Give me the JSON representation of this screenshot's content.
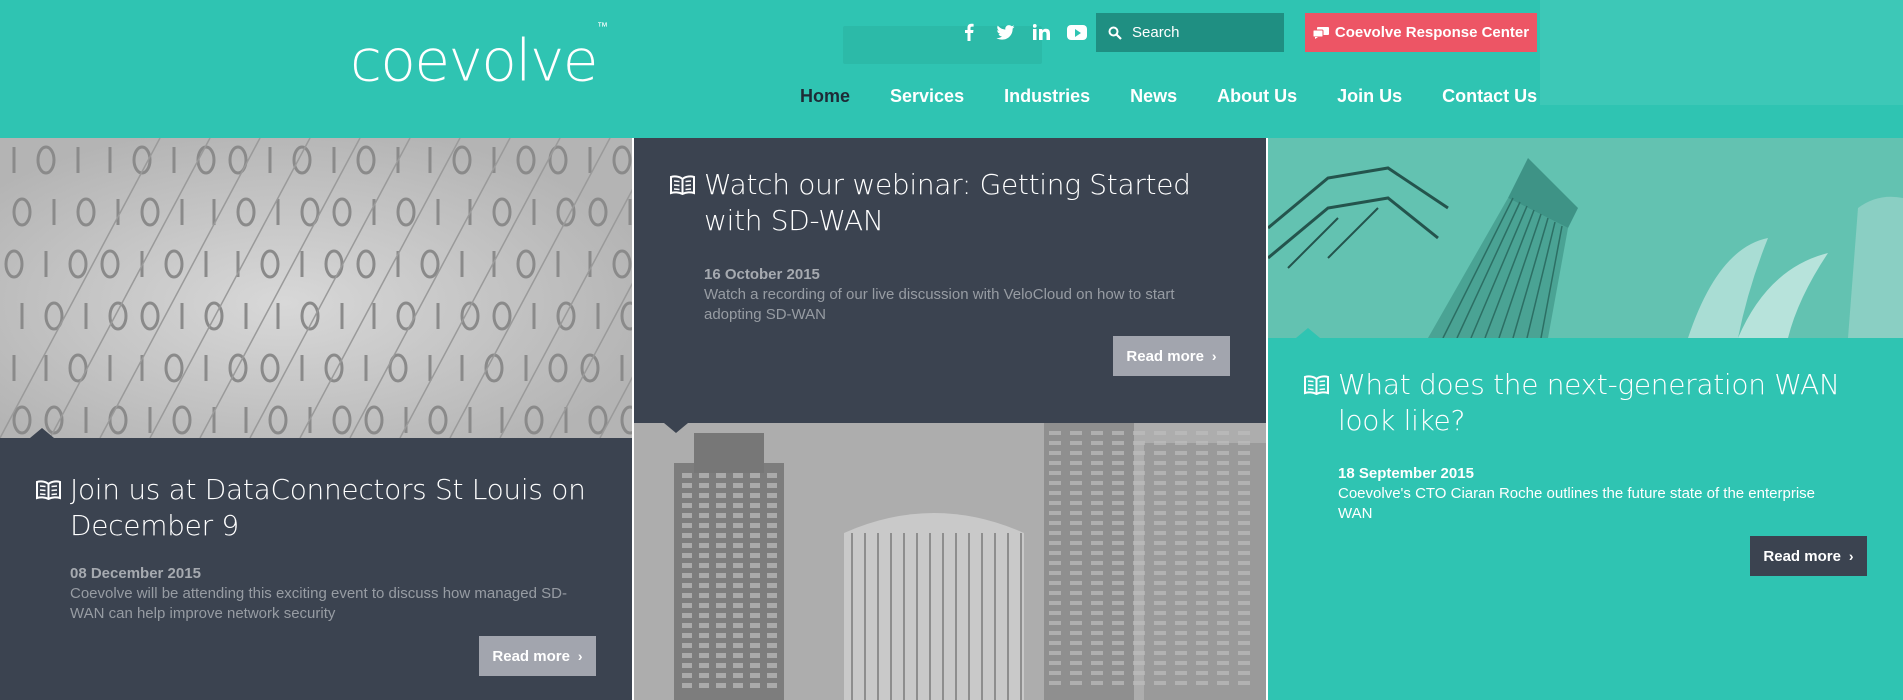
{
  "brand": {
    "logo_text": "coevolve",
    "trademark": "™"
  },
  "colors": {
    "teal": "#2fc4b2",
    "dark": "#3b4350",
    "red": "#ed5565",
    "grey_button": "#a2a5ae"
  },
  "social": [
    "facebook-icon",
    "twitter-icon",
    "linkedin-icon",
    "youtube-icon"
  ],
  "search": {
    "placeholder": "Search"
  },
  "response_center": {
    "label": "Coevolve Response Center"
  },
  "nav": {
    "items": [
      {
        "label": "Home"
      },
      {
        "label": "Services"
      },
      {
        "label": "Industries"
      },
      {
        "label": "News"
      },
      {
        "label": "About Us"
      },
      {
        "label": "Join Us"
      },
      {
        "label": "Contact Us"
      }
    ]
  },
  "cards": [
    {
      "title": "Join us at DataConnectors St Louis on December 9",
      "date": "08 December 2015",
      "desc": "Coevolve will be attending this exciting event to discuss how managed SD-WAN can help improve network security",
      "button": "Read more"
    },
    {
      "title": "Watch our webinar: Getting Started with SD-WAN",
      "date": "16 October 2015",
      "desc": "Watch a recording of our live discussion with VeloCloud on how to start adopting SD-WAN",
      "button": "Read more"
    },
    {
      "title": "What does the next-generation WAN look like?",
      "date": "18 September 2015",
      "desc": "Coevolve's CTO Ciaran Roche outlines the future state of the enterprise WAN",
      "button": "Read more"
    }
  ]
}
